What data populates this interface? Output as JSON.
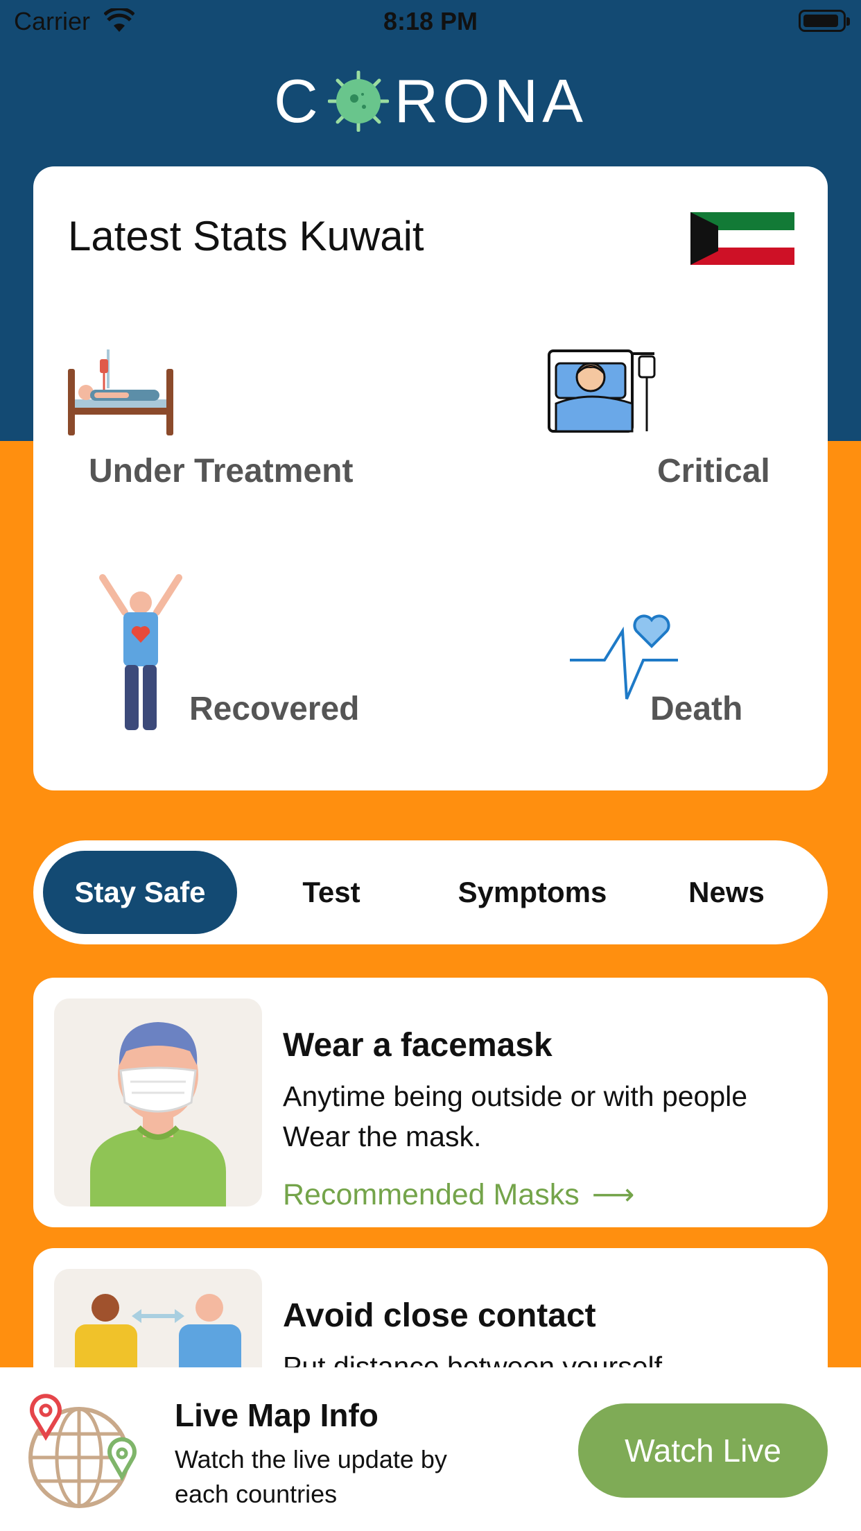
{
  "status_bar": {
    "carrier": "Carrier",
    "time": "8:18 PM"
  },
  "header": {
    "logo_left": "C",
    "logo_right": "RONA"
  },
  "stats": {
    "title": "Latest Stats Kuwait",
    "flag_icon": "kuwait-flag",
    "items": [
      {
        "label": "Under Treatment",
        "icon": "hospital-bed-icon"
      },
      {
        "label": "Critical",
        "icon": "patient-in-bed-icon"
      },
      {
        "label": "Recovered",
        "icon": "recovered-person-icon"
      },
      {
        "label": "Death",
        "icon": "heartbeat-icon"
      }
    ]
  },
  "tabs": [
    "Stay Safe",
    "Test",
    "Symptoms",
    "News"
  ],
  "active_tab": "Stay Safe",
  "cards": [
    {
      "title": "Wear a facemask",
      "desc": "Anytime being outside or with people Wear the mask.",
      "link": "Recommended Masks",
      "icon": "facemask-person-icon"
    },
    {
      "title": "Avoid close contact",
      "desc": "Put distance between yourself",
      "icon": "social-distance-icon"
    }
  ],
  "bottom": {
    "title": "Live Map Info",
    "desc": "Watch the live update by each countries",
    "button": "Watch Live",
    "icon": "globe-pin-icon"
  },
  "colors": {
    "primary": "#134A73",
    "background": "#FF8F0F",
    "accent_green": "#7FAB56",
    "link_green": "#74A44A"
  }
}
